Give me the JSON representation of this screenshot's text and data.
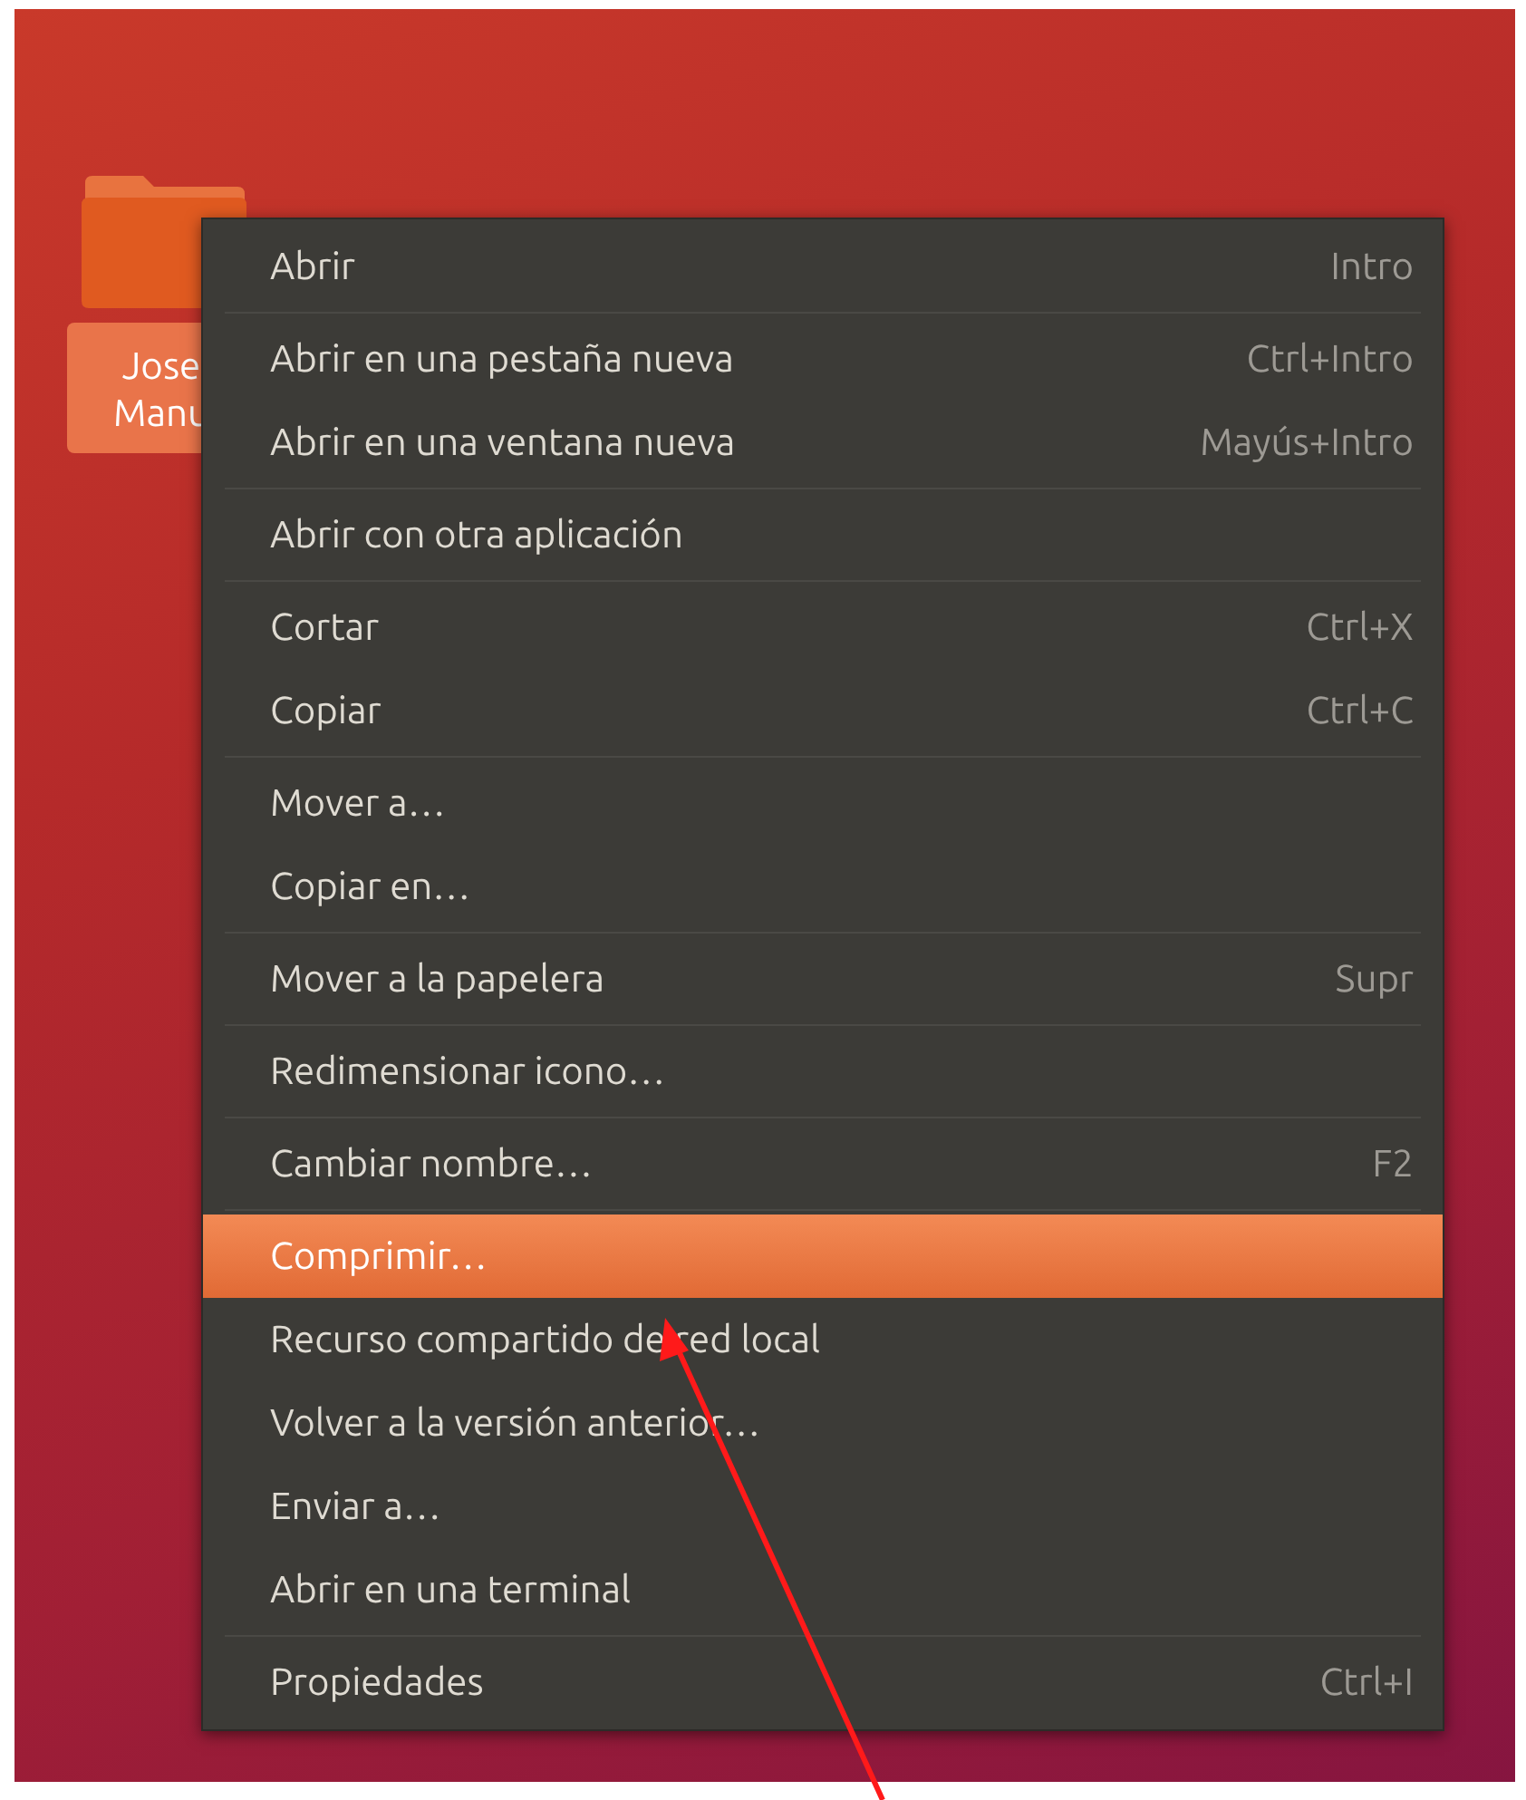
{
  "desktop_icon": {
    "label_lines": [
      "Jose",
      "Manu"
    ],
    "selected": true
  },
  "context_menu": {
    "sections": [
      {
        "items": [
          {
            "label": "Abrir",
            "shortcut": "Intro",
            "selected": false
          }
        ]
      },
      {
        "items": [
          {
            "label": "Abrir en una pestaña nueva",
            "shortcut": "Ctrl+Intro",
            "selected": false
          },
          {
            "label": "Abrir en una ventana nueva",
            "shortcut": "Mayús+Intro",
            "selected": false
          }
        ]
      },
      {
        "items": [
          {
            "label": "Abrir con otra aplicación",
            "selected": false
          }
        ]
      },
      {
        "items": [
          {
            "label": "Cortar",
            "shortcut": "Ctrl+X",
            "selected": false
          },
          {
            "label": "Copiar",
            "shortcut": "Ctrl+C",
            "selected": false
          }
        ]
      },
      {
        "items": [
          {
            "label": "Mover a…",
            "selected": false
          },
          {
            "label": "Copiar en…",
            "selected": false
          }
        ]
      },
      {
        "items": [
          {
            "label": "Mover a la papelera",
            "shortcut": "Supr",
            "selected": false
          }
        ]
      },
      {
        "items": [
          {
            "label": "Redimensionar icono…",
            "selected": false
          }
        ]
      },
      {
        "items": [
          {
            "label": "Cambiar nombre…",
            "shortcut": "F2",
            "selected": false
          }
        ]
      },
      {
        "items": [
          {
            "label": "Comprimir…",
            "selected": true
          },
          {
            "label": "Recurso compartido de red local",
            "selected": false
          },
          {
            "label": "Volver a la versión anterior…",
            "selected": false
          },
          {
            "label": "Enviar a…",
            "selected": false
          },
          {
            "label": "Abrir en una terminal",
            "selected": false
          }
        ]
      },
      {
        "items": [
          {
            "label": "Propiedades",
            "shortcut": "Ctrl+I",
            "selected": false
          }
        ]
      }
    ]
  }
}
